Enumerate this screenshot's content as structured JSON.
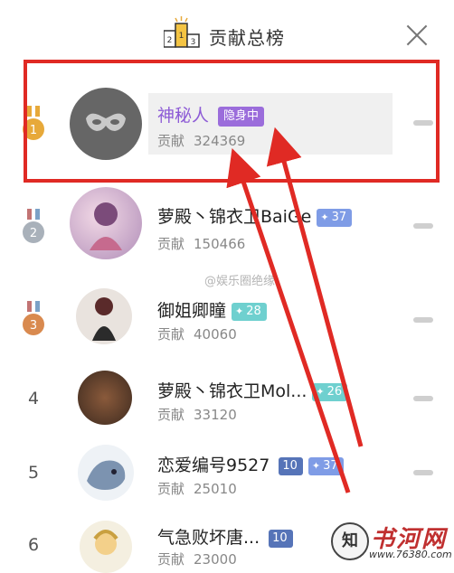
{
  "header": {
    "title": "贡献总榜",
    "podium_icon": "podium-icon",
    "close_icon": "close-icon"
  },
  "contribution_label": "贡献",
  "rows": [
    {
      "rank": "1",
      "name": "神秘人",
      "tag": "隐身中",
      "contribution": "324369",
      "avatar": "mystery-mask-avatar"
    },
    {
      "rank": "2",
      "name": "萝殿丶锦衣卫BaiGe",
      "level": "37",
      "contribution": "150466",
      "avatar": "user-avatar"
    },
    {
      "rank": "3",
      "name": "御姐卿瞳",
      "level": "28",
      "contribution": "40060",
      "avatar": "user-avatar"
    },
    {
      "rank": "4",
      "name": "萝殿丶锦衣卫Mol...",
      "level": "26",
      "contribution": "33120",
      "avatar": "user-avatar"
    },
    {
      "rank": "5",
      "name": "恋爱编号9527",
      "noble_badge": "10",
      "level": "37",
      "contribution": "25010",
      "avatar": "user-avatar"
    },
    {
      "rank": "6",
      "name": "气急败坏唐...",
      "noble_badge": "10",
      "contribution": "23000",
      "avatar": "user-avatar"
    }
  ],
  "watermark": "@娱乐圈绝缘",
  "site_logo": {
    "glyph": "知",
    "text": "书河网",
    "url": "www.76380.com"
  },
  "colors": {
    "highlight_red": "#e02a24",
    "hidden_badge_purple": "#9b6ddb",
    "name_purple": "#8d5bd6",
    "level_blue": "#7f9ce6",
    "level_teal": "#6fd0cf",
    "gold": "#e7a93a",
    "silver": "#a9b1ba",
    "bronze": "#d98a4f"
  }
}
